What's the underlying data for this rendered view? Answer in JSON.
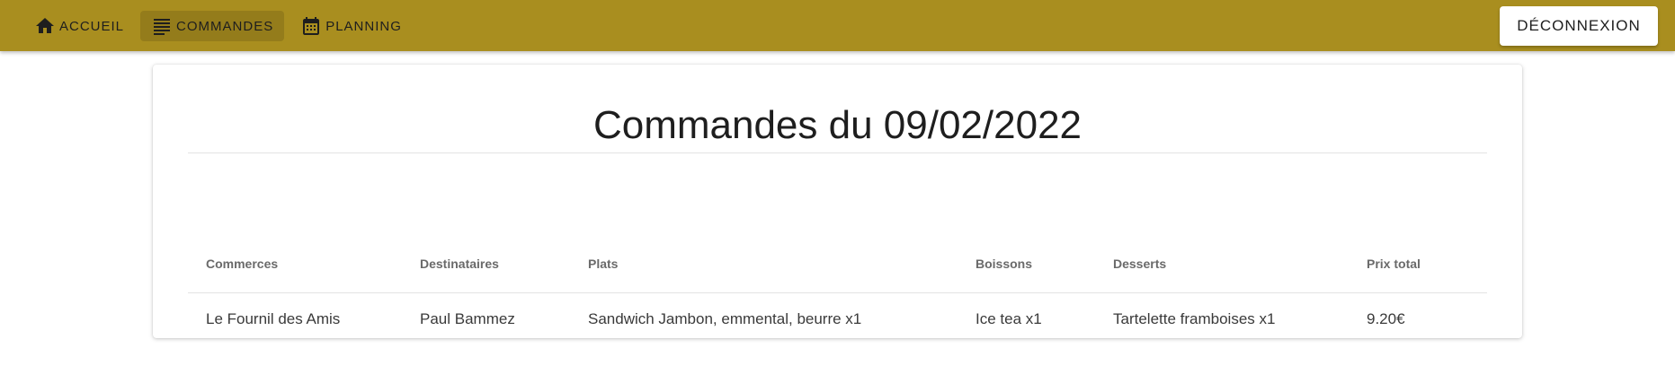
{
  "nav": {
    "items": [
      {
        "label": "Accueil",
        "icon": "home-icon",
        "active": false
      },
      {
        "label": "Commandes",
        "icon": "list-icon",
        "active": true
      },
      {
        "label": "Planning",
        "icon": "calendar-icon",
        "active": false
      }
    ],
    "logout_label": "Déconnexion"
  },
  "colors": {
    "topbar": "#a98e1f",
    "active_tab": "rgba(0,0,0,0.12)"
  },
  "page": {
    "title": "Commandes du 09/02/2022"
  },
  "table": {
    "headers": [
      "Commerces",
      "Destinataires",
      "Plats",
      "Boissons",
      "Desserts",
      "Prix total"
    ],
    "rows": [
      [
        "Le Fournil des Amis",
        "Paul Bammez",
        "Sandwich Jambon, emmental, beurre x1",
        "Ice tea x1",
        "Tartelette framboises x1",
        "9.20€"
      ]
    ]
  }
}
